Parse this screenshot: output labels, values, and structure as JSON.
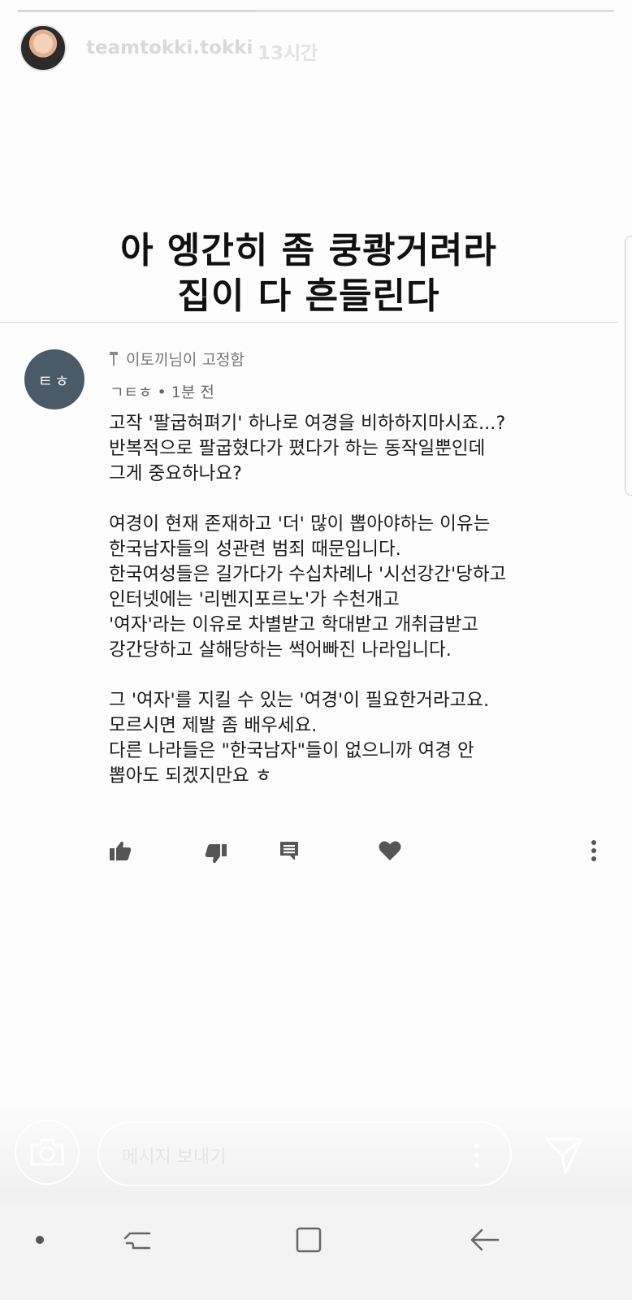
{
  "story": {
    "username": "teamtokki.tokki",
    "time_ago": "13시간",
    "progress_fraction": 0.4
  },
  "post": {
    "title_line1": "아 엥간히 좀 쿵쾅거려라",
    "title_line2": "집이 다 흔들린다"
  },
  "comment": {
    "avatar_initials": "ㅌㅎ",
    "pinned_label": "이토끼님이 고정함",
    "author": "ㄱㅌㅎ",
    "time": "1분 전",
    "lines": [
      "고작 '팔굽혀펴기' 하나로 여경을 비하하지마시죠...?",
      "반복적으로 팔굽혔다가 폈다가 하는 동작일뿐인데",
      "그게 중요하나요?",
      "",
      "여경이 현재 존재하고 '더' 많이 뽑아야하는 이유는",
      "한국남자들의 성관련 범죄 때문입니다.",
      "한국여성들은 길가다가 수십차례나 '시선강간'당하고",
      "인터넷에는 '리벤지포르노'가 수천개고",
      "'여자'라는 이유로 차별받고 학대받고 개취급받고",
      "강간당하고 살해당하는 썩어빠진 나라입니다.",
      "",
      "그 '여자'를 지킬 수 있는 '여경'이 필요한거라고요.",
      "모르시면 제발 좀 배우세요.",
      "다른 나라들은 \"한국남자\"들이 없으니까 여경 안",
      "뽑아도 되겠지만요 ㅎ"
    ]
  },
  "message_bar": {
    "placeholder": "메시지 보내기"
  },
  "icons": {
    "like": "thumbs-up-icon",
    "dislike": "thumbs-down-icon",
    "reply": "comment-icon",
    "heart": "heart-icon",
    "more": "more-vertical-icon",
    "camera": "camera-icon",
    "send": "send-icon"
  },
  "colors": {
    "avatar_bg": "#4a5a66",
    "text": "#1a1a1a",
    "icon": "#555555"
  }
}
